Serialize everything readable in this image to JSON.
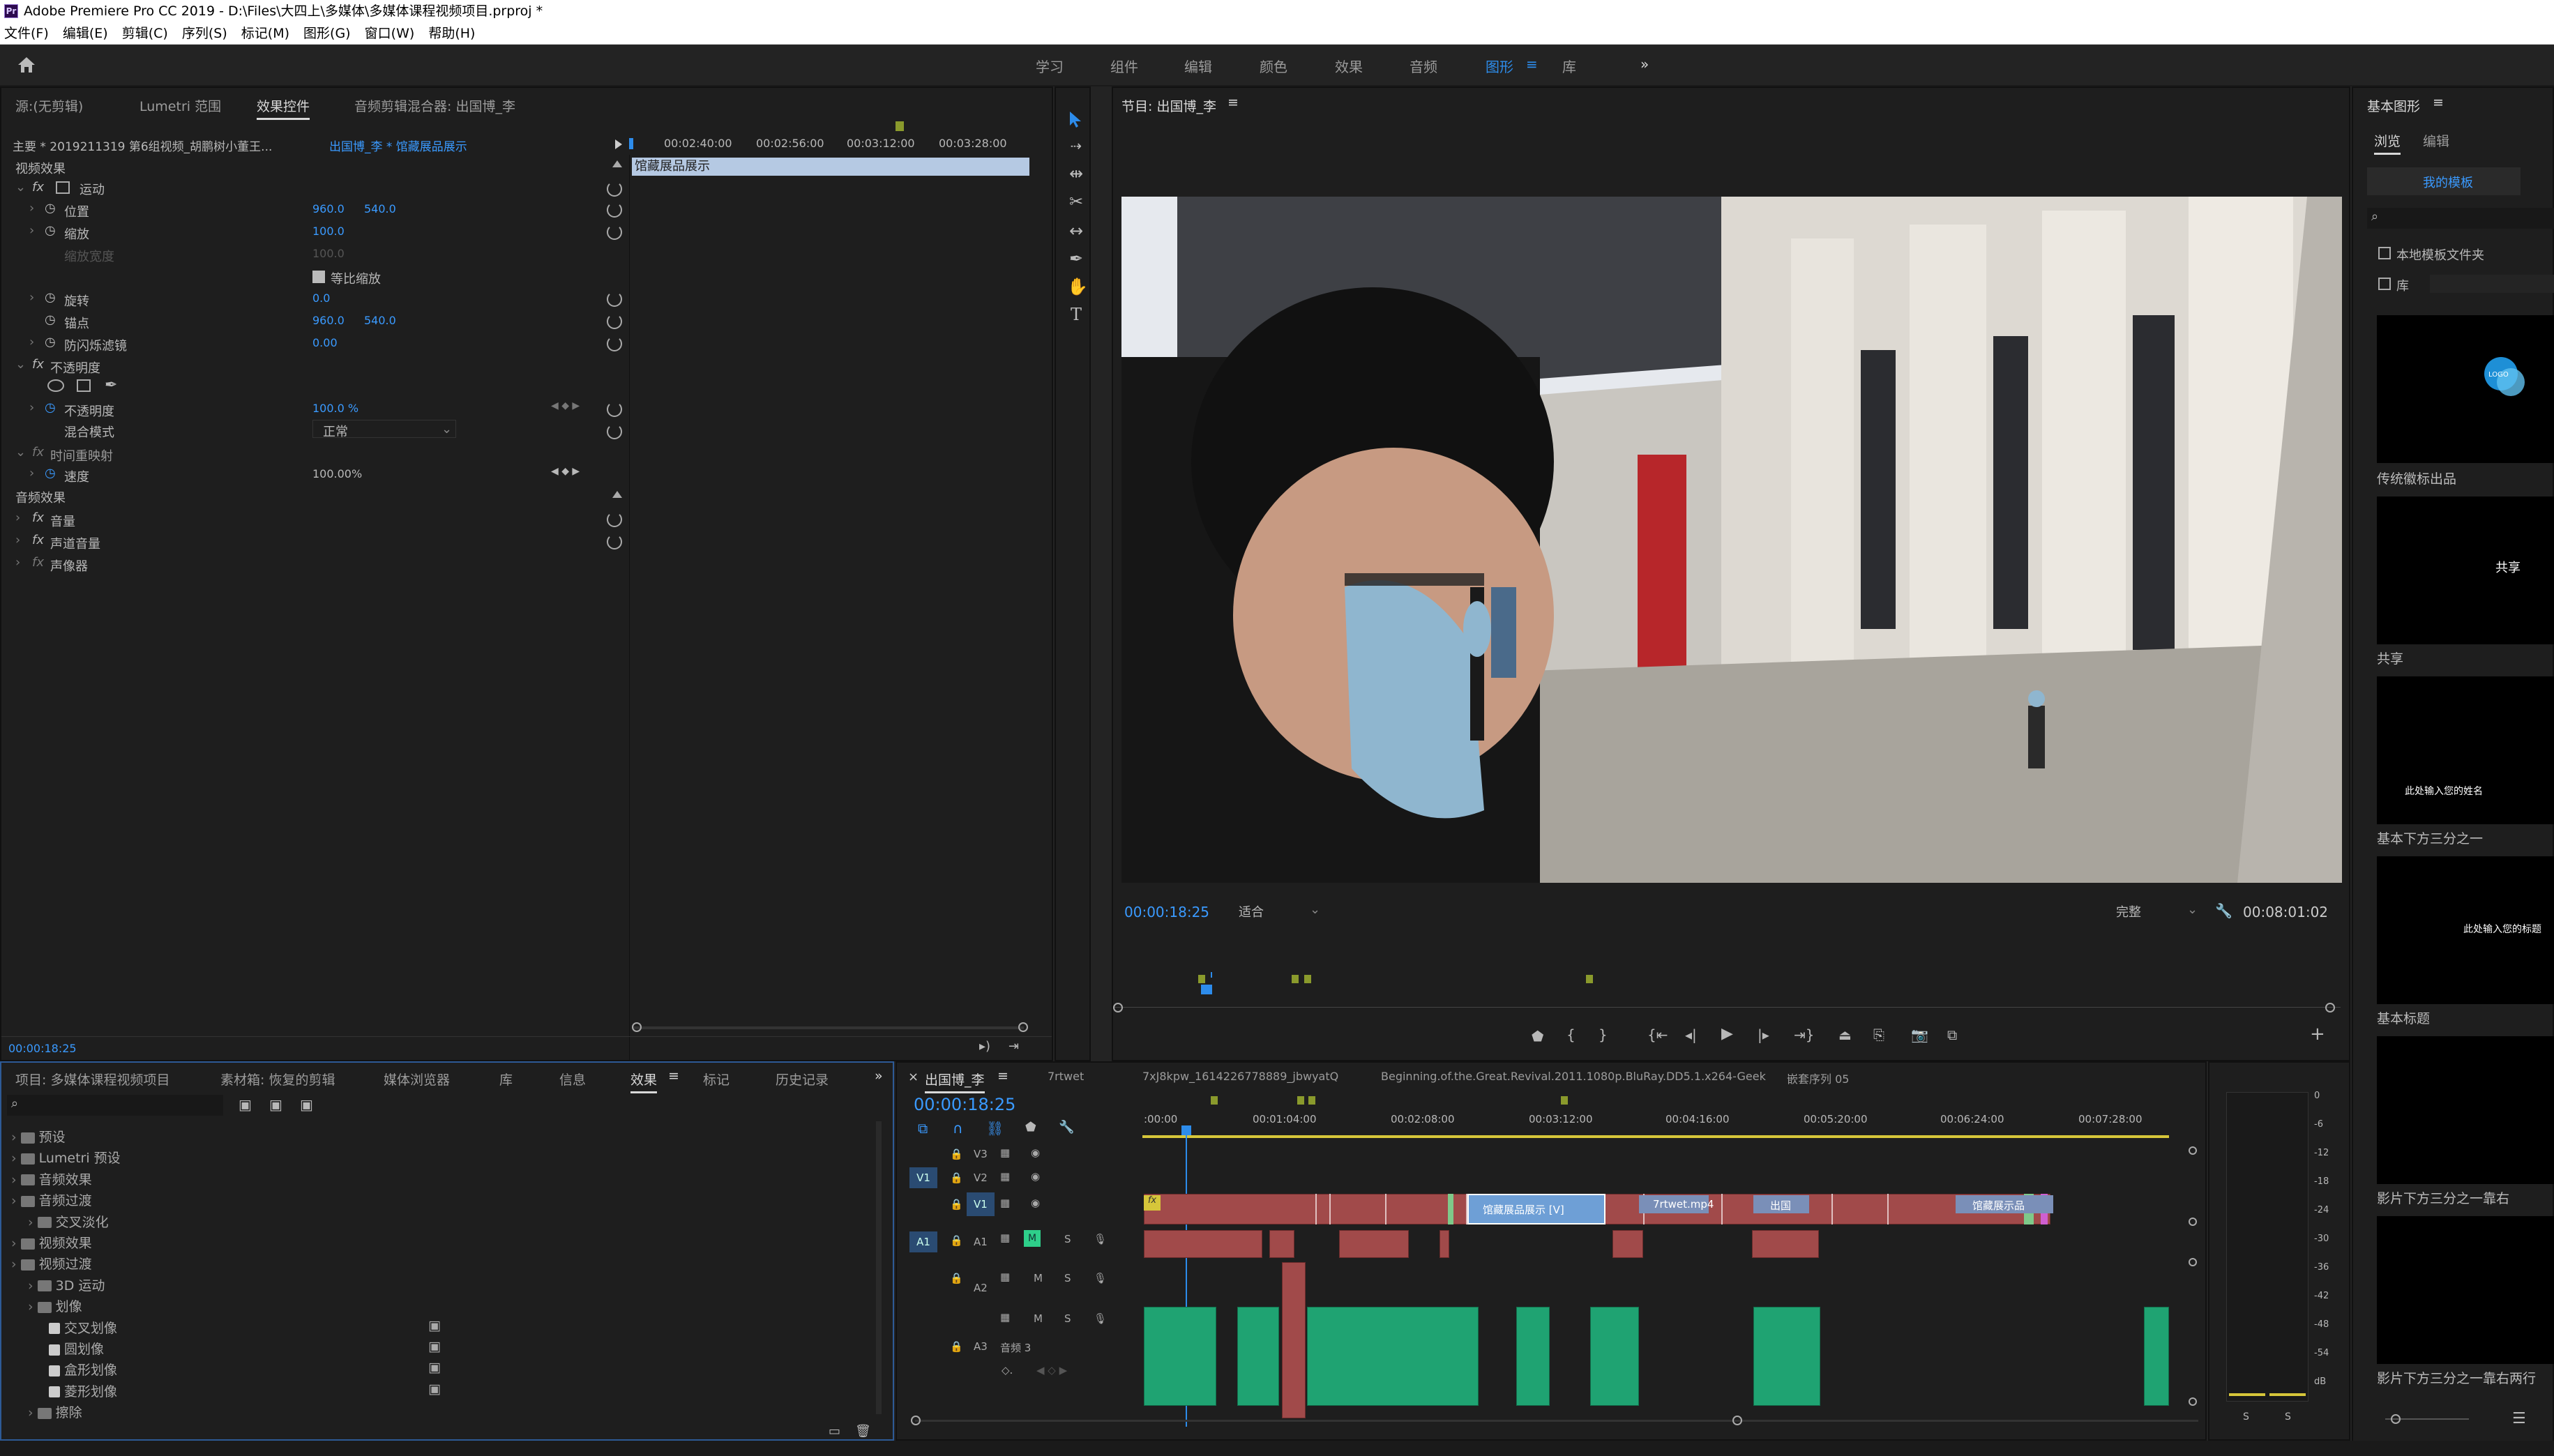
{
  "app": {
    "title": "Adobe Premiere Pro CC 2019 - D:\\Files\\大四上\\多媒体\\多媒体课程视频项目.prproj *",
    "logo_text": "Pr"
  },
  "menu": [
    "文件(F)",
    "编辑(E)",
    "剪辑(C)",
    "序列(S)",
    "标记(M)",
    "图形(G)",
    "窗口(W)",
    "帮助(H)"
  ],
  "workspaces": {
    "items": [
      "学习",
      "组件",
      "编辑",
      "颜色",
      "效果",
      "音频",
      "图形",
      "库"
    ],
    "active": "图形",
    "menu_glyph": "≡",
    "more": "»"
  },
  "source_panel": {
    "tabs": [
      "源:(无剪辑)",
      "Lumetri 范围",
      "效果控件",
      "音频剪辑混合器: 出国博_李"
    ],
    "active_tab": "效果控件",
    "master": "主要 * 2019211319 第6组视频_胡鹏树小董王...",
    "clip_path": "出国博_李 * 馆藏展品展示",
    "timecodes": [
      "00:02:40:00",
      "00:02:56:00",
      "00:03:12:00",
      "00:03:28:00"
    ],
    "clip_bar": "馆藏展品展示",
    "video_effects_header": "视频效果",
    "motion": "运动",
    "position_label": "位置",
    "position_x": "960.0",
    "position_y": "540.0",
    "scale_label": "缩放",
    "scale": "100.0",
    "scale_width_label": "缩放宽度",
    "scale_width": "100.0",
    "uniform_scale": "等比缩放",
    "rotation_label": "旋转",
    "rotation": "0.0",
    "anchor_label": "锚点",
    "anchor_x": "960.0",
    "anchor_y": "540.0",
    "flicker_label": "防闪烁滤镜",
    "flicker": "0.00",
    "opacity_group": "不透明度",
    "opacity_label": "不透明度",
    "opacity": "100.0 %",
    "blend_label": "混合模式",
    "blend": "正常",
    "time_remap": "时间重映射",
    "speed_label": "速度",
    "speed": "100.00%",
    "audio_effects_header": "音频效果",
    "volume": "音量",
    "channel_volume": "声道音量",
    "panner": "声像器",
    "current_time": "00:00:18:25"
  },
  "program": {
    "title": "节目: 出国博_李",
    "timecode": "00:00:18:25",
    "fit": "适合",
    "quality": "完整",
    "duration": "00:08:01:02"
  },
  "project_panel": {
    "tabs": [
      "项目: 多媒体课程视频项目",
      "素材箱: 恢复的剪辑",
      "媒体浏览器",
      "库",
      "信息",
      "效果",
      "标记",
      "历史记录"
    ],
    "active_tab": "效果",
    "tree": [
      {
        "label": "预设",
        "indent": 0
      },
      {
        "label": "Lumetri 预设",
        "indent": 0
      },
      {
        "label": "音频效果",
        "indent": 0
      },
      {
        "label": "音频过渡",
        "indent": 0
      },
      {
        "label": "交叉淡化",
        "indent": 1
      },
      {
        "label": "视频效果",
        "indent": 0
      },
      {
        "label": "视频过渡",
        "indent": 0
      },
      {
        "label": "3D 运动",
        "indent": 1
      },
      {
        "label": "划像",
        "indent": 1
      },
      {
        "label": "交叉划像",
        "indent": 2
      },
      {
        "label": "圆划像",
        "indent": 2
      },
      {
        "label": "盒形划像",
        "indent": 2
      },
      {
        "label": "菱形划像",
        "indent": 2
      },
      {
        "label": "擦除",
        "indent": 1
      }
    ]
  },
  "timeline": {
    "tabs": [
      "出国博_李",
      "7rtwet",
      "7xJ8kpw_1614226778889_jbwyatQ",
      "Beginning.of.the.Great.Revival.2011.1080p.BluRay.DD5.1.x264-Geek",
      "嵌套序列 05"
    ],
    "active_tab": "出国博_李",
    "timecode": "00:00:18:25",
    "ruler": [
      ":00:00",
      "00:01:04:00",
      "00:02:08:00",
      "00:03:12:00",
      "00:04:16:00",
      "00:05:20:00",
      "00:06:24:00",
      "00:07:28:00"
    ],
    "tracks": [
      "V3",
      "V2",
      "V1",
      "A1",
      "A2",
      "A3"
    ],
    "a3_name": "音频 3",
    "clips": {
      "c1": "馆藏展品展示 [V]",
      "c2": "7rtwet.mp4",
      "c3": "出国",
      "c4": "馆藏展示品"
    },
    "meter_scale": [
      "0",
      "-6",
      "-12",
      "-18",
      "-24",
      "-30",
      "-36",
      "-42",
      "-48",
      "-54",
      "dB"
    ],
    "solo": "S"
  },
  "essential_graphics": {
    "title": "基本图形",
    "tabs": [
      "浏览",
      "编辑"
    ],
    "active_tab": "浏览",
    "my_templates": "我的模板",
    "local_folder": "本地模板文件夹",
    "library": "库",
    "templates": [
      {
        "name": "传统徽标出品",
        "preview": "LOGO"
      },
      {
        "name": "共享",
        "preview": "共享"
      },
      {
        "name": "基本下方三分之一",
        "preview": "此处输入您的姓名"
      },
      {
        "name": "基本标题",
        "preview": "此处输入您的标题"
      },
      {
        "name": "影片下方三分之一靠右",
        "preview": ""
      },
      {
        "name": "影片下方三分之一靠右两行",
        "preview": ""
      }
    ]
  },
  "colors": {
    "accent": "#2d8ceb",
    "video_clip": "#a14a4a",
    "audio_clip": "#1fa372",
    "selected_clip": "#6e9fd6",
    "panel_bg": "#1e1e1e"
  }
}
